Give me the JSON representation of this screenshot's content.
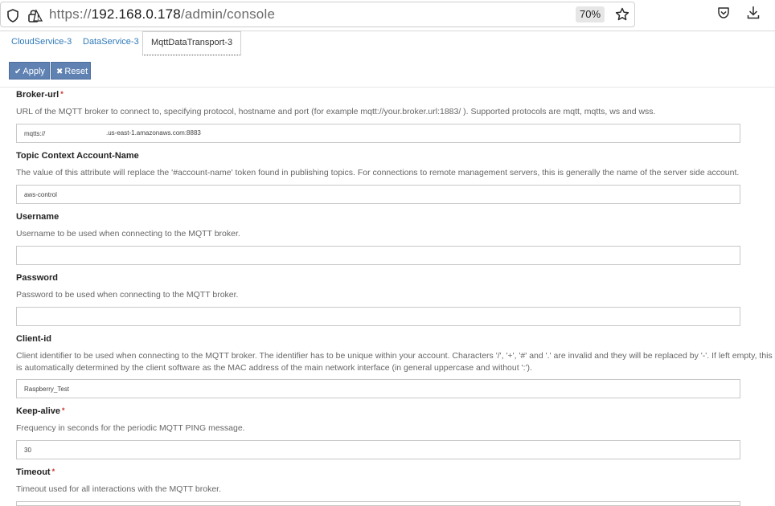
{
  "browser": {
    "url_scheme": "https://",
    "url_host": "192.168.0.178",
    "url_path": "/admin/console",
    "zoom": "70%"
  },
  "tabs": [
    {
      "label": "CloudService-3"
    },
    {
      "label": "DataService-3"
    },
    {
      "label": "MqttDataTransport-3"
    }
  ],
  "toolbar": {
    "apply_label": "Apply",
    "reset_label": "Reset"
  },
  "fields": {
    "broker_url": {
      "label": "Broker-url",
      "required": "*",
      "description": "URL of the MQTT broker to connect to, specifying protocol, hostname and port (for example mqtt://your.broker.url:1883/ ). Supported protocols are mqtt, mqtts, ws and wss.",
      "value": "mqtts://",
      "value_suffix": ".us-east-1.amazonaws.com:8883"
    },
    "topic_context": {
      "label": "Topic Context Account-Name",
      "description": "The value of this attribute will replace the '#account-name' token found in publishing topics. For connections to remote management servers, this is generally the name of the server side account.",
      "value": "aws-control"
    },
    "username": {
      "label": "Username",
      "description": "Username to be used when connecting to the MQTT broker.",
      "value": ""
    },
    "password": {
      "label": "Password",
      "description": "Password to be used when connecting to the MQTT broker.",
      "value": ""
    },
    "client_id": {
      "label": "Client-id",
      "description": "Client identifier to be used when connecting to the MQTT broker. The identifier has to be unique within your account. Characters '/', '+', '#' and '.' are invalid and they will be replaced by '-'. If left empty, this is automatically determined by the client software as the MAC address of the main network interface (in general uppercase and without ':').",
      "value": "Raspberry_Test"
    },
    "keep_alive": {
      "label": "Keep-alive",
      "required": "*",
      "description": "Frequency in seconds for the periodic MQTT PING message.",
      "value": "30"
    },
    "timeout": {
      "label": "Timeout",
      "required": "*",
      "description": "Timeout used for all interactions with the MQTT broker.",
      "value": ""
    }
  }
}
